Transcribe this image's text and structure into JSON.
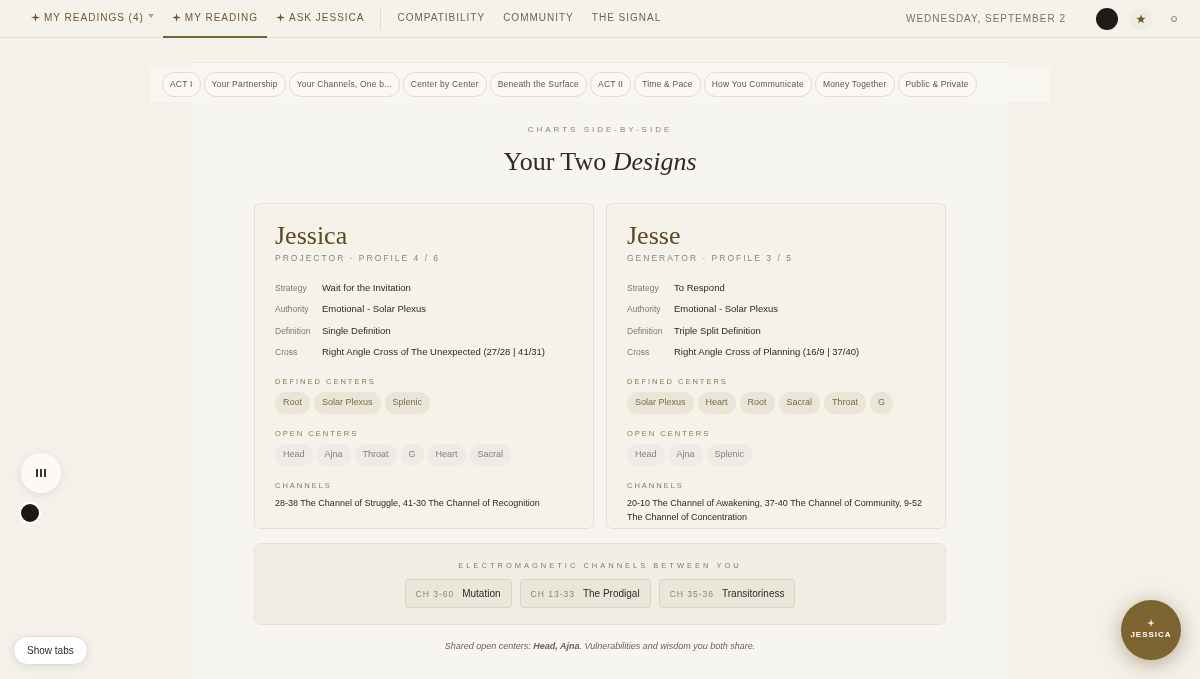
{
  "nav": {
    "items": [
      {
        "label": "MY READINGS (4)",
        "kind": "featured",
        "dropdown": true,
        "selected": false
      },
      {
        "label": "MY READING",
        "kind": "featured",
        "dropdown": false,
        "selected": true
      },
      {
        "label": "ASK JESSICA",
        "kind": "featured",
        "dropdown": false,
        "selected": false
      },
      {
        "label": "COMPATIBILITY",
        "kind": "plain",
        "dropdown": false,
        "selected": false
      },
      {
        "label": "COMMUNITY",
        "kind": "plain",
        "dropdown": false,
        "selected": false
      },
      {
        "label": "THE SIGNAL",
        "kind": "plain",
        "dropdown": false,
        "selected": false
      }
    ],
    "date": "WEDNESDAY, SEPTEMBER 2"
  },
  "section_tabs": [
    "ACT I",
    "Your Partnership",
    "Your Channels, One b...",
    "Center by Center",
    "Beneath the Surface",
    "ACT II",
    "Time & Pace",
    "How You Communicate",
    "Money Together",
    "Public & Private"
  ],
  "eyebrow": "CHARTS SIDE-BY-SIDE",
  "heading": "Your Two *Designs*",
  "people": [
    {
      "name": "Jessica",
      "subtitle": "PROJECTOR · PROFILE 4 / 6",
      "facts": [
        {
          "label": "Strategy",
          "value": "Wait for the Invitation"
        },
        {
          "label": "Authority",
          "value": "Emotional - Solar Plexus"
        },
        {
          "label": "Definition",
          "value": "Single Definition"
        },
        {
          "label": "Cross",
          "value": "Right Angle Cross of The Unexpected (27/28 | 41/31)"
        }
      ],
      "defined_title": "DEFINED CENTERS",
      "defined_centers": [
        "Root",
        "Solar Plexus",
        "Splenic"
      ],
      "open_title": "OPEN CENTERS",
      "open_centers": [
        "Head",
        "Ajna",
        "Throat",
        "G",
        "Heart",
        "Sacral"
      ],
      "channels_title": "CHANNELS",
      "channels": "28-38 The Channel of Struggle, 41-30 The Channel of Recognition"
    },
    {
      "name": "Jesse",
      "subtitle": "GENERATOR · PROFILE 3 / 5",
      "facts": [
        {
          "label": "Strategy",
          "value": "To Respond"
        },
        {
          "label": "Authority",
          "value": "Emotional - Solar Plexus"
        },
        {
          "label": "Definition",
          "value": "Triple Split Definition"
        },
        {
          "label": "Cross",
          "value": "Right Angle Cross of Planning (16/9 | 37/40)"
        }
      ],
      "defined_title": "DEFINED CENTERS",
      "defined_centers": [
        "Solar Plexus",
        "Heart",
        "Root",
        "Sacral",
        "Throat",
        "G"
      ],
      "open_title": "OPEN CENTERS",
      "open_centers": [
        "Head",
        "Ajna",
        "Splenic"
      ],
      "channels_title": "CHANNELS",
      "channels": "20-10 The Channel of Awakening, 37-40 The Channel of Community, 9-52 The Channel of Concentration"
    }
  ],
  "em_channels": {
    "title": "ELECTROMAGNETIC CHANNELS BETWEEN YOU",
    "items": [
      {
        "code": "CH 3-60",
        "name": "Mutation"
      },
      {
        "code": "CH 13-33",
        "name": "The Prodigal"
      },
      {
        "code": "CH 35-36",
        "name": "Transitoriness"
      }
    ]
  },
  "note": "Shared open centers: **Head, Ajna**. Vulnerabilities and wisdom you both share.",
  "show_tabs_button": "Show tabs",
  "assistant_button": "JESSICA"
}
